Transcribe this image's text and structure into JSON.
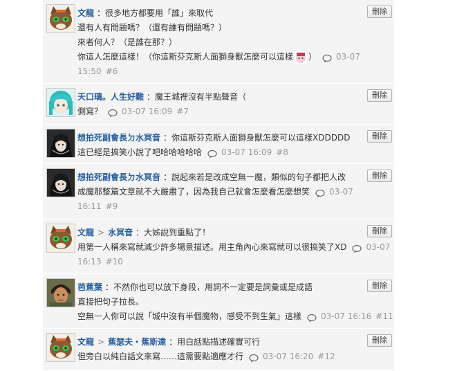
{
  "delete_label": "刪除",
  "comments": [
    {
      "author": "文龍",
      "avatar": "cat-avatar",
      "lines": [
        "很多地方都要用「誰」來取代",
        "還有人有問題嗎？（還有誰有問題嗎？）",
        "來者何人？（是誰在那？）",
        "你這人怎麼這樣！（你這斯芬克斯人面獅身獸怎麼可以這樣"
      ],
      "date": "03-07",
      "time": "15:50",
      "floor": "#6"
    },
    {
      "author": "天口璃。人生好難",
      "avatar": "teal-hair-avatar",
      "lines": [
        "魔王城裡沒有半點聲音（",
        "側寫？"
      ],
      "datetime": "03-07 16:09",
      "floor": "#7"
    },
    {
      "author": "想拍死副會長ㄉ水冥音",
      "avatar": "dark-hair-avatar",
      "lines": [
        "你這斯芬克斯人面獅身獸怎麼可以這樣XDDDDD",
        "這已經是搞笑小說了吧哈哈哈哈哈"
      ],
      "datetime": "03-07 16:09",
      "floor": "#8"
    },
    {
      "author": "想拍死副會長ㄉ水冥音",
      "avatar": "dark-hair-avatar",
      "lines": [
        "說起來若是改成空無一魔，類似的句子都把人改",
        "成魔那整篇文章就不大嚴肅了，因為我自己就會怎麼看怎麼想笑"
      ],
      "date": "03-07",
      "time": "16:11",
      "floor": "#9"
    },
    {
      "author": "文龍",
      "reply_to": "水冥音",
      "avatar": "cat-avatar",
      "lines": [
        "大姊說到重點了！",
        "用第一人稱來寫就減少許多場景描述。用主角內心來寫就可以很搞笑了XD"
      ],
      "date": "03-07",
      "time": "16:13",
      "floor": "#10"
    },
    {
      "author": "芭蕉葉",
      "avatar": "warrior-avatar",
      "lines": [
        "不然你也可以放下身段，用詞不一定要是詞彙或是成語",
        "直接把句子拉長。",
        "空無一人你可以說「城中沒有半個魔物，感受不到生氣」這樣"
      ],
      "datetime": "03-07 16:16",
      "floor": "#11"
    },
    {
      "author": "文龍",
      "reply_to": "蕉瑟夫・蕉斯達",
      "avatar": "cat-avatar",
      "lines": [
        "用白話點描述確實可行",
        "但旁白以純白話文來寫……這需要點適應才行"
      ],
      "datetime": "03-07 16:20",
      "floor": "#12"
    }
  ]
}
